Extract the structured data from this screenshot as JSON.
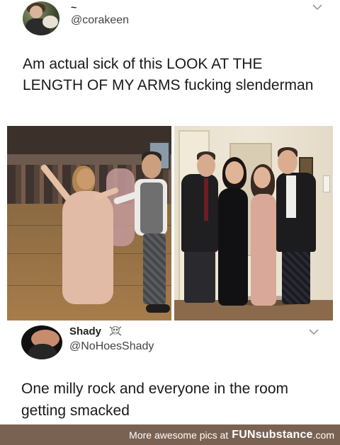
{
  "tweet1": {
    "display_name": "~",
    "handle": "@corakeen",
    "text": "Am actual sick of this LOOK AT THE LENGTH OF MY ARMS fucking slenderman",
    "icons": {
      "avatar": "profile-photo",
      "menu": "chevron-down-icon"
    }
  },
  "photos": {
    "left": {
      "description_icon": "dancing-couple-photo"
    },
    "right": {
      "description_icon": "group-of-four-photo"
    }
  },
  "tweet2": {
    "display_name": "Shady",
    "emoji": "☠️",
    "handle": "@NoHoesShady",
    "text": "One milly rock and everyone in the room getting smacked",
    "icons": {
      "avatar": "profile-photo",
      "menu": "chevron-down-icon"
    }
  },
  "footer": {
    "prefix": "More awesome pics at",
    "brand": "FUNsubstance",
    "suffix": ".com",
    "bg_color": "#7a6252"
  }
}
